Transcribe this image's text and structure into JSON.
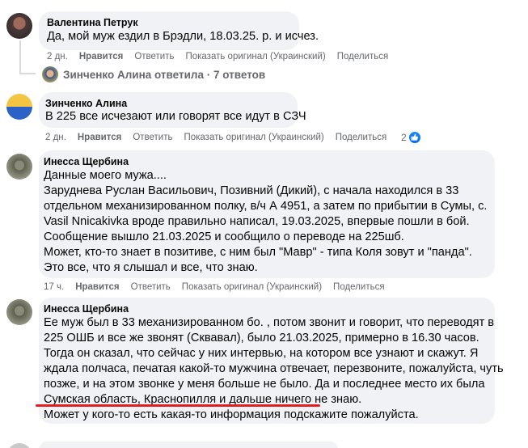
{
  "comments": [
    {
      "author": "Валентина Петрук",
      "lines": [
        "Да, мой муж ездил в Брэдли, 18.03.25. р. и исчез."
      ],
      "time": "2 дн.",
      "like_label": "Нравится",
      "reply_label": "Ответить",
      "original_label": "Показать оригинал (Украинский)",
      "share_label": "Поделиться"
    },
    {
      "author": "Зинченко Алина",
      "lines": [
        "В 225 все исчезают или говорят все идут в СЗЧ"
      ],
      "time": "2 дн.",
      "like_label": "Нравится",
      "reply_label": "Ответить",
      "original_label": "Показать оригинал (Украинский)",
      "share_label": "Поделиться",
      "reaction_count": "2"
    },
    {
      "author": "Инесса Щербина",
      "lines": [
        "Данные моего мужа....",
        "Заруднева Руслан Васильович, Позивний (Дикий), с начала находился в 33",
        "отдельном механизированном полку, в/ч А 4951, а затем по прибытии в Сумы, с.",
        "Vasil Nnicakivka вроде правильно написал, 19.03.2025, впервые пошли в бой.",
        "Сообщение вышло 21.03.2025 и сообщило о переводе на 225шб.",
        "Может, кто-то знает в позитиве, с ним был \"Мавр\" - типа Коля зовут и \"панда\".",
        "Это все, что я слышал и все, что знаю."
      ],
      "time": "17 ч.",
      "like_label": "Нравится",
      "reply_label": "Ответить",
      "original_label": "Показать оригинал (Украинский)",
      "share_label": "Поделиться"
    },
    {
      "author": "Инесса Щербина",
      "lines": [
        "Ее муж был в 33 механизированном бо. , потом звонит и говорит, что переводят в",
        "225 ОШБ и все же звонят (Сквавал), было 21.03.2025, примерно в 16.30 часов.",
        "Тогда он сказал, что сейчас у них интервью, на котором все узнают и скажут. Я",
        "ждала полчаса, печатая какой-то мужчина отвечает, перезвоните, пожалуйста, чуть",
        "позже, и на этом звонке у меня больше не было. Да и последнее место их была",
        "Сумская область, Краснопилля и дальше ничего не знаю.",
        "Может у кого-то есть какая-то информация подскажите пожалуйста."
      ]
    }
  ],
  "reply_summary": "Зинченко Алина ответила · 7 ответов",
  "colors": {
    "bubble": "#f0f2f5",
    "muted_text": "#65676b",
    "like_blue": "#0866ff",
    "underline_red": "#e02020"
  },
  "icons": [
    "avatar",
    "like-icon"
  ]
}
